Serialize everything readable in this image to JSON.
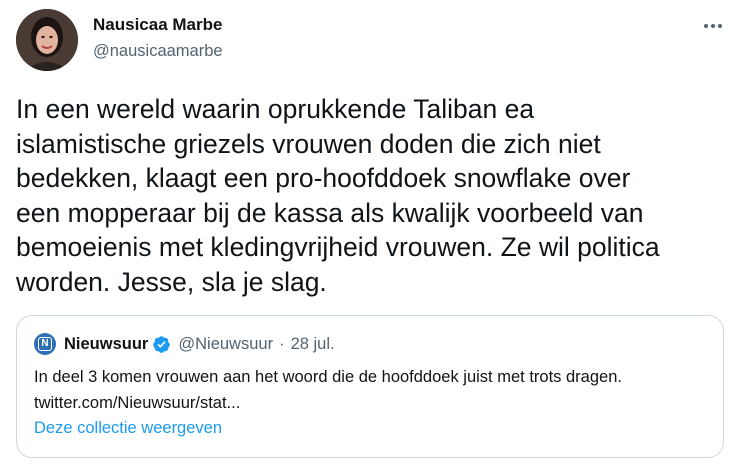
{
  "author": {
    "display_name": "Nausicaa Marbe",
    "handle": "@nausicaamarbe"
  },
  "tweet": {
    "text": "In een wereld waarin oprukkende Taliban ea\nislamistische griezels vrouwen doden die zich niet\nbedekken, klaagt een pro-hoofddoek snowflake over\neen mopperaar bij de kassa als kwalijk voorbeeld van\nbemoeienis met kledingvrijheid vrouwen. Ze wil politica\nworden. Jesse, sla je slag."
  },
  "quoted_tweet": {
    "avatar_letter": "N",
    "display_name": "Nieuwsuur",
    "handle": "@Nieuwsuur",
    "separator": "·",
    "date": "28 jul.",
    "text_line1": "In deel 3 komen vrouwen aan het woord die de hoofddoek juist met trots dragen.",
    "text_line2": "twitter.com/Nieuwsuur/stat...",
    "collection_link": "Deze collectie weergeven"
  },
  "icons": {
    "more": "more-horizontal-icon",
    "verified": "verified-badge-icon"
  },
  "colors": {
    "text": "#0f1419",
    "secondary": "#536471",
    "link": "#1d9bf0",
    "border": "#cfd9de",
    "verified": "#1d9bf0",
    "nieuwsuur_brand": "#2f6fb4"
  }
}
